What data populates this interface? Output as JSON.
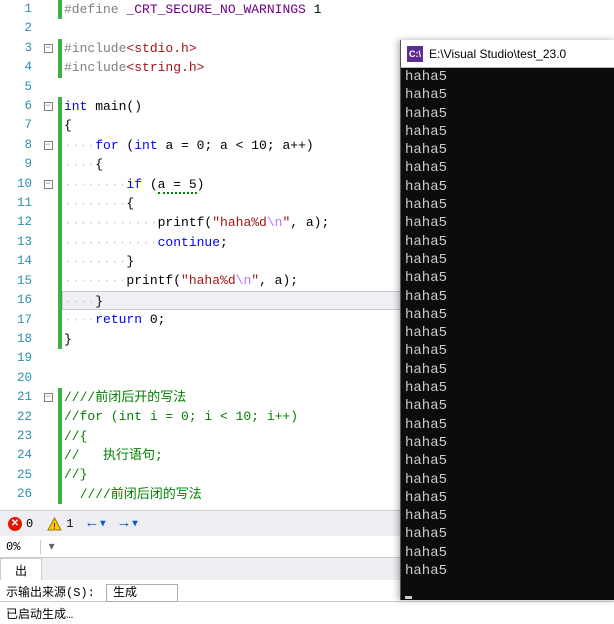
{
  "editor": {
    "lines": [
      1,
      2,
      3,
      4,
      5,
      6,
      7,
      8,
      9,
      10,
      11,
      12,
      13,
      14,
      15,
      16,
      17,
      18,
      19,
      20,
      21,
      22,
      23,
      24,
      25,
      26
    ],
    "folds": {
      "3": "−",
      "6": "−",
      "8": "−",
      "10": "−",
      "21": "−"
    },
    "changed": [
      1,
      3,
      4,
      6,
      7,
      8,
      9,
      10,
      11,
      12,
      13,
      14,
      15,
      16,
      17,
      18,
      21,
      22,
      23,
      24,
      25,
      26
    ],
    "code": {
      "1": "#define _CRT_SECURE_NO_WARNINGS 1",
      "3": "#include<stdio.h>",
      "4": "#include<string.h>",
      "6": "int main()",
      "7": "{",
      "8": "    for (int a = 0; a < 10; a++)",
      "9": "    {",
      "10": "        if (a = 5)",
      "11": "        {",
      "12": "            printf(\"haha%d\\n\", a);",
      "13": "            continue;",
      "14": "        }",
      "15": "        printf(\"haha%d\\n\", a);",
      "16": "    }",
      "17": "    return 0;",
      "18": "}",
      "21": "////前闭后开的写法",
      "22": "//for (int i = 0; i < 10; i++)",
      "23": "//{",
      "24": "//   执行语句;",
      "25": "//}",
      "26": "  ////前闭后闭的写法"
    }
  },
  "statusbar": {
    "errors": "0",
    "warnings": "1",
    "nav_left": "←",
    "nav_right": "→"
  },
  "pct": "0%",
  "tab": "出",
  "output": {
    "label": "示输出来源(S):",
    "value": "生成"
  },
  "build": "已启动生成…",
  "console": {
    "title": "E:\\Visual Studio\\test_23.0",
    "line": "haha5",
    "repeat": 28
  }
}
